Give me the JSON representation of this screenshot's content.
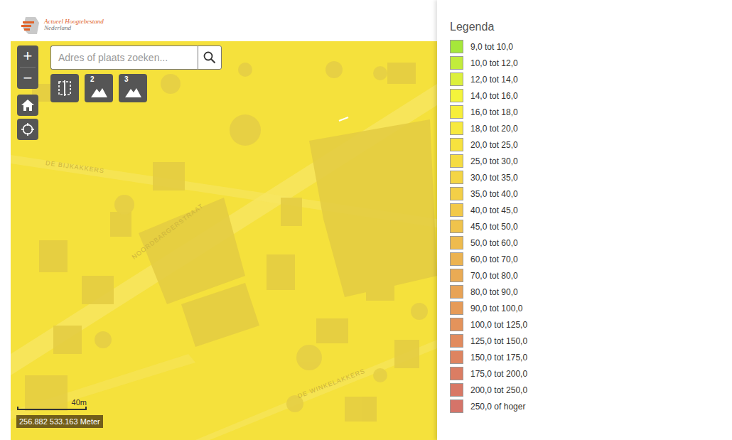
{
  "header": {
    "logo_line1": "Actueel Hoogtebestand",
    "logo_line2": "Nederland"
  },
  "zoom": {
    "in": "+",
    "out": "−"
  },
  "search": {
    "placeholder": "Adres of plaats zoeken..."
  },
  "tools": [
    {
      "kind": "split",
      "label": ""
    },
    {
      "kind": "view",
      "label": "2"
    },
    {
      "kind": "view",
      "label": "3"
    }
  ],
  "map": {
    "streets": [
      {
        "name": "DE BIJKAKKERS"
      },
      {
        "name": "NOORDBARGERSTRAAT"
      },
      {
        "name": "DE WINKELAKKERS"
      }
    ]
  },
  "scale": {
    "label": "40m"
  },
  "coordinates": "256.882 533.163 Meter",
  "legend": {
    "title": "Legenda",
    "items": [
      {
        "label": "9,0 tot 10,0",
        "color": "#a6e83a"
      },
      {
        "label": "10,0 tot 12,0",
        "color": "#c2ec3c"
      },
      {
        "label": "12,0 tot 14,0",
        "color": "#dcf03c"
      },
      {
        "label": "14,0 tot 16,0",
        "color": "#f4f43c"
      },
      {
        "label": "16,0 tot 18,0",
        "color": "#f7ef3a"
      },
      {
        "label": "18,0 tot 20,0",
        "color": "#f7e93e"
      },
      {
        "label": "20,0 tot 25,0",
        "color": "#f7e23f"
      },
      {
        "label": "25,0 tot 30,0",
        "color": "#f5dc42"
      },
      {
        "label": "30,0 tot 35,0",
        "color": "#f4d545"
      },
      {
        "label": "35,0 tot 40,0",
        "color": "#f3cf48"
      },
      {
        "label": "40,0 tot 45,0",
        "color": "#f2c94a"
      },
      {
        "label": "45,0 tot 50,0",
        "color": "#f0c34c"
      },
      {
        "label": "50,0 tot 60,0",
        "color": "#eebb4e"
      },
      {
        "label": "60,0 tot 70,0",
        "color": "#ecb351"
      },
      {
        "label": "70,0 tot 80,0",
        "color": "#eaab54"
      },
      {
        "label": "80,0 tot 90,0",
        "color": "#e8a356"
      },
      {
        "label": "90,0 tot 100,0",
        "color": "#e69b58"
      },
      {
        "label": "100,0 tot 125,0",
        "color": "#e4935b"
      },
      {
        "label": "125,0 tot 150,0",
        "color": "#e18b5e"
      },
      {
        "label": "150,0 tot 175,0",
        "color": "#de8460"
      },
      {
        "label": "175,0 tot 200,0",
        "color": "#db7d63"
      },
      {
        "label": "200,0 tot 250,0",
        "color": "#d87866"
      },
      {
        "label": "250,0 of hoger",
        "color": "#d57469"
      }
    ]
  }
}
